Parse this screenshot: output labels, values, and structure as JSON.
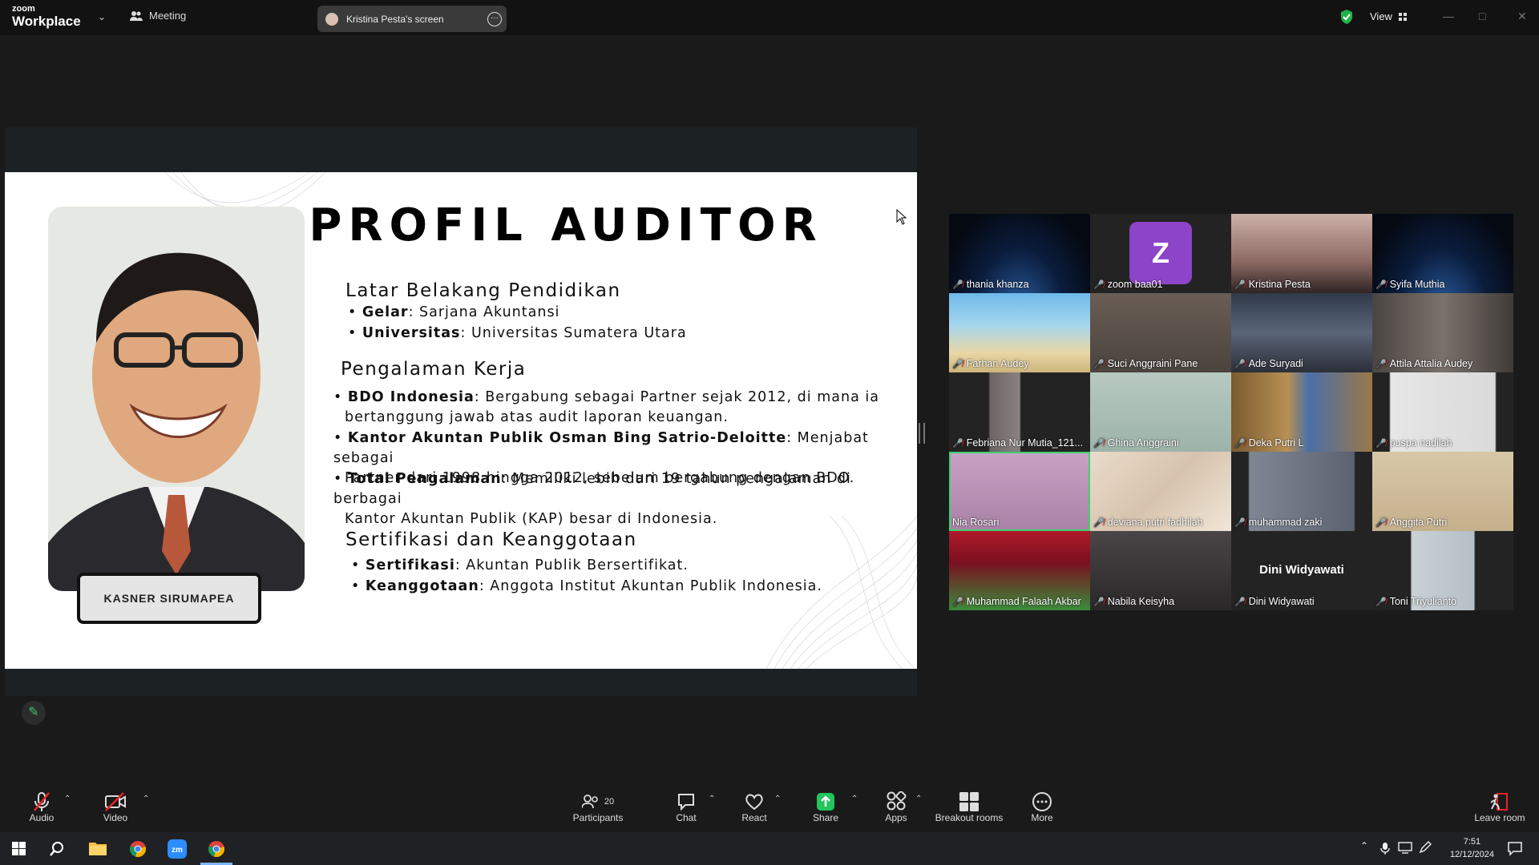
{
  "titlebar": {
    "logo_small": "zoom",
    "logo_main": "Workplace",
    "meeting_label": "Meeting",
    "screen_label": "Kristina Pesta's screen",
    "view_label": "View"
  },
  "slide": {
    "title": "PROFIL AUDITOR",
    "person_name": "KASNER SIRUMAPEA",
    "sec1": "Latar Belakang Pendidikan",
    "sec1_items": [
      {
        "key": "Gelar",
        "text": ": Sarjana Akuntansi"
      },
      {
        "key": "Universitas",
        "text": ": Universitas Sumatera Utara"
      }
    ],
    "sec2": "Pengalaman Kerja",
    "sec2_items": [
      {
        "key": "BDO Indonesia",
        "text": ": Bergabung sebagai Partner sejak 2012, di mana ia",
        "cont": "bertanggung jawab atas audit laporan keuangan."
      },
      {
        "key": "Kantor Akuntan Publik Osman Bing Satrio-Deloitte",
        "text": ": Menjabat sebagai",
        "cont": "Partner dari 1998 hingga 2012, sebelum bergabung dengan BDO."
      },
      {
        "key": "Total Pengalaman",
        "text": ": Memiliki lebih dari 19 tahun pengalaman di berbagai",
        "cont": "Kantor Akuntan Publik (KAP) besar di Indonesia."
      }
    ],
    "sec3": "Sertifikasi dan Keanggotaan",
    "sec3_items": [
      {
        "key": "Sertifikasi",
        "text": ": Akuntan Publik Bersertifikat."
      },
      {
        "key": "Keanggotaan",
        "text": ": Anggota Institut Akuntan Publik Indonesia."
      }
    ]
  },
  "participants": [
    {
      "name": "thania khanza"
    },
    {
      "name": "zoom baa01",
      "initial": "Z"
    },
    {
      "name": "Kristina Pesta"
    },
    {
      "name": "Syifa Muthia"
    },
    {
      "name": "Farhan Audey"
    },
    {
      "name": "Suci Anggraini Pane"
    },
    {
      "name": "Ade Suryadi"
    },
    {
      "name": "Attila Attalia Audey"
    },
    {
      "name": "Febriana Nur Mutia_121..."
    },
    {
      "name": "Ghina Anggraini"
    },
    {
      "name": "Deka Putri L"
    },
    {
      "name": "puspa nadilah"
    },
    {
      "name": "Nia Rosari"
    },
    {
      "name": "deviana putri fadhilah"
    },
    {
      "name": "muhammad zaki"
    },
    {
      "name": "Anggita Putri"
    },
    {
      "name": "Muhammad Falaah Akbar"
    },
    {
      "name": "Nabila Keisyha"
    },
    {
      "name": "Dini Widyawati",
      "display_name": "Dini Widyawati"
    },
    {
      "name": "Toni Triyulianto"
    }
  ],
  "toolbar": {
    "audio": "Audio",
    "video": "Video",
    "participants": "Participants",
    "participants_count": "20",
    "chat": "Chat",
    "react": "React",
    "share": "Share",
    "apps": "Apps",
    "breakout": "Breakout rooms",
    "more": "More",
    "leave": "Leave room"
  },
  "taskbar": {
    "time": "7:51",
    "date": "12/12/2024"
  },
  "colors": {
    "active_speaker": "#3ed16d",
    "share_green": "#22c55e",
    "mic_off": "#e22222"
  }
}
